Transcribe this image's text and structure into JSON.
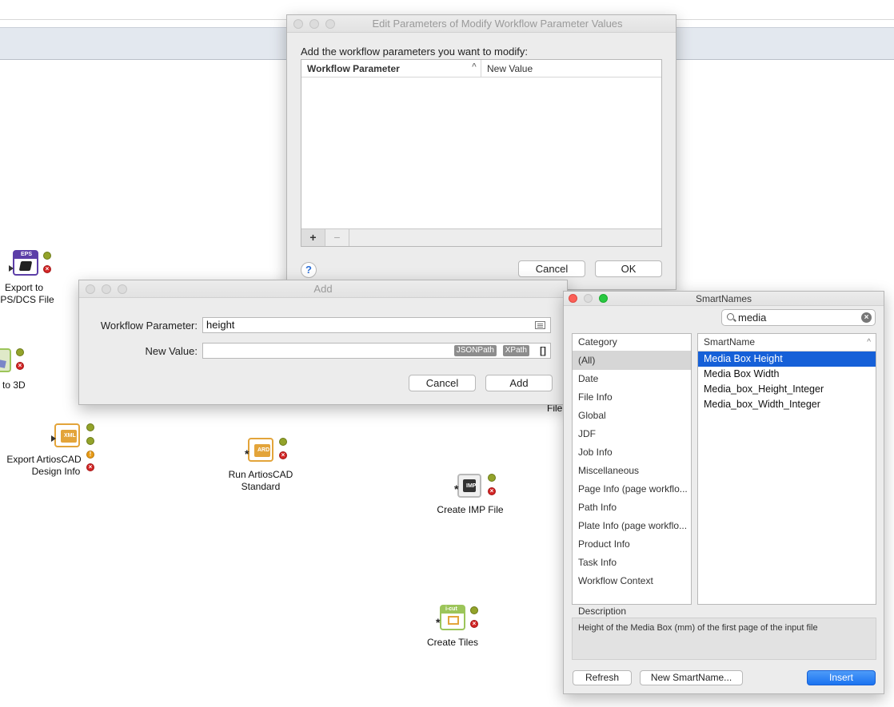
{
  "canvas": {
    "nodes": [
      {
        "name": "export-eps",
        "label_lines": [
          "Export to",
          "EPS/DCS File"
        ],
        "badge": "EPS",
        "color": "#5c3ea8"
      },
      {
        "name": "to-3d",
        "label_lines": [
          "to 3D"
        ],
        "badge": "",
        "color": "#9cc55a"
      },
      {
        "name": "export-artioscad",
        "label_lines": [
          "Export ArtiosCAD",
          "Design Info"
        ],
        "badge": "XML",
        "color": "#e3a43a"
      },
      {
        "name": "run-artioscad",
        "label_lines": [
          "Run ArtiosCAD",
          "Standard"
        ],
        "badge": "ARD",
        "color": "#e3a43a"
      },
      {
        "name": "create-imp",
        "label_lines": [
          "Create IMP File"
        ],
        "badge": "IMP",
        "color": "#bcbcbc"
      },
      {
        "name": "create-tiles",
        "label_lines": [
          "Create Tiles"
        ],
        "badge": "i-cut",
        "color": "#9cc55a"
      },
      {
        "name": "partial-file",
        "label_lines": [
          "File"
        ],
        "badge": "",
        "color": ""
      }
    ]
  },
  "edit_dialog": {
    "title": "Edit Parameters of Modify Workflow Parameter Values",
    "instruction": "Add the workflow parameters you want to modify:",
    "columns": [
      "Workflow Parameter",
      "New Value"
    ],
    "plus_label": "+",
    "minus_label": "−",
    "help_label": "?",
    "cancel_label": "Cancel",
    "ok_label": "OK"
  },
  "add_dialog": {
    "title": "Add",
    "param_label": "Workflow Parameter:",
    "param_value": "height",
    "value_label": "New Value:",
    "value_value": "",
    "chip_jsonpath": "JSONPath",
    "chip_xpath": "XPath",
    "brackets": "[]",
    "cancel_label": "Cancel",
    "add_label": "Add"
  },
  "smartnames": {
    "title": "SmartNames",
    "search_value": "media",
    "clear_glyph": "×",
    "category_header": "Category",
    "categories": [
      "(All)",
      "Date",
      "File Info",
      "Global",
      "JDF",
      "Job Info",
      "Miscellaneous",
      "Page Info (page workflo...",
      "Path Info",
      "Plate Info (page workflo...",
      "Product Info",
      "Task Info",
      "Workflow Context"
    ],
    "selected_category": "(All)",
    "smartname_header": "SmartName",
    "items": [
      "Media Box Height",
      "Media Box Width",
      "Media_box_Height_Integer",
      "Media_box_Width_Integer"
    ],
    "selected_item": "Media Box Height",
    "description_label": "Description",
    "description": "Height of the Media Box (mm) of the first page of the input file",
    "refresh_label": "Refresh",
    "new_label": "New SmartName...",
    "insert_label": "Insert"
  }
}
